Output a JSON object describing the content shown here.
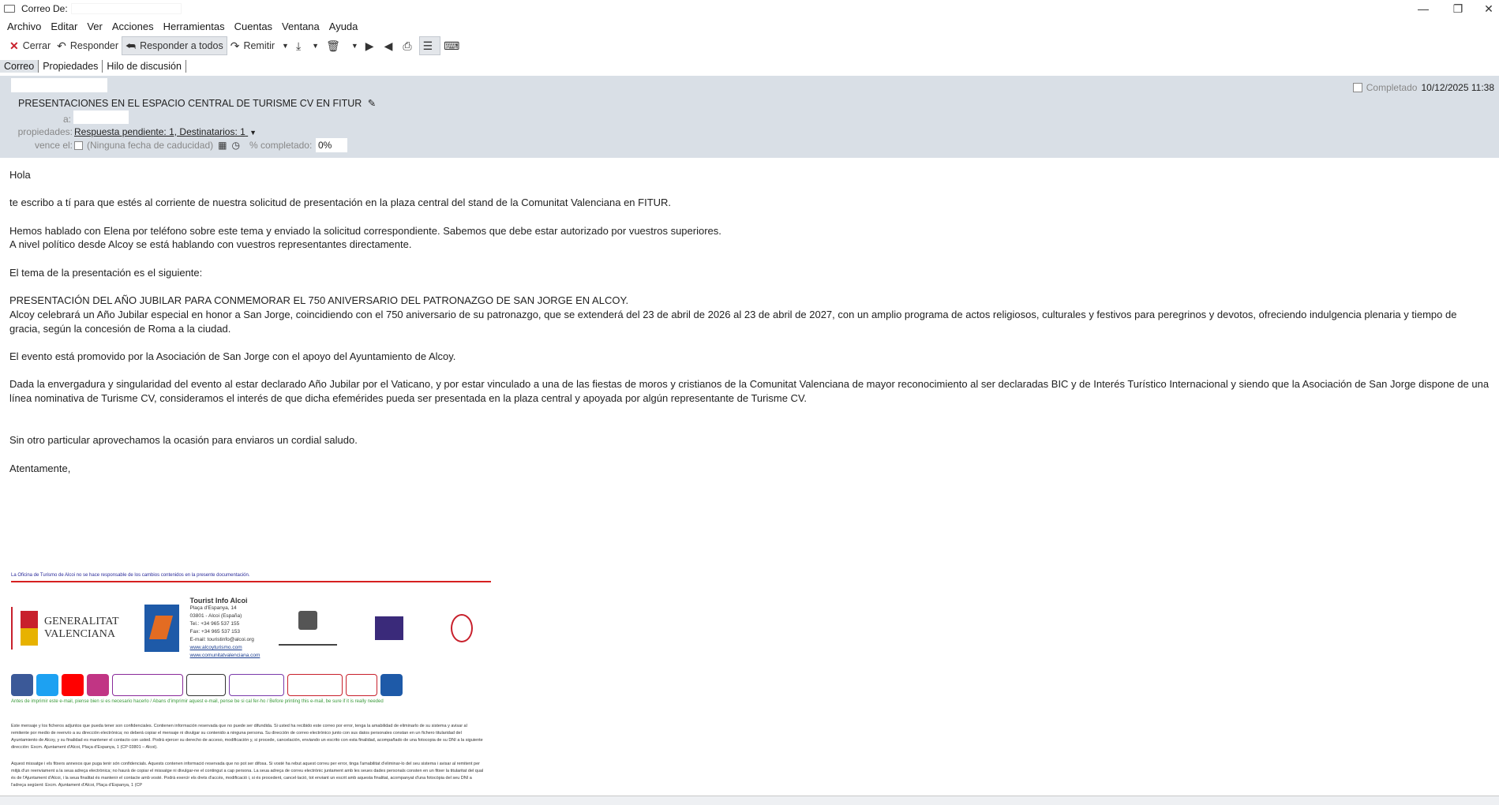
{
  "window": {
    "title": "Correo De:",
    "minimize": "—",
    "maximize": "❐",
    "close": "✕"
  },
  "menu": [
    "Archivo",
    "Editar",
    "Ver",
    "Acciones",
    "Herramientas",
    "Cuentas",
    "Ventana",
    "Ayuda"
  ],
  "toolbar": {
    "close_label": "Cerrar",
    "reply_label": "Responder",
    "reply_all_label": "Responder a todos",
    "forward_label": "Remitir"
  },
  "tabs": [
    "Correo",
    "Propiedades",
    "Hilo de discusión"
  ],
  "header": {
    "subject": "PRESENTACIONES EN EL ESPACIO CENTRAL DE TURISME CV EN FITUR",
    "completed_label": "Completado",
    "date": "10/12/2025 11:38",
    "to_label": "a:",
    "props_label": "propiedades:",
    "props_value": "Respuesta pendiente: 1, Destinatarios: 1",
    "expires_label": "vence el:",
    "expires_value": "(Ninguna fecha de caducidad)",
    "pct_label": "% completado:",
    "pct_value": "0%"
  },
  "body": {
    "p1": "Hola",
    "p2": "te escribo a tí para que estés al corriente de nuestra solicitud de presentación en la plaza central del stand de la Comunitat Valenciana en FITUR.",
    "p3a": "Hemos hablado con Elena por teléfono sobre este tema y enviado la solicitud correspondiente. Sabemos que debe estar autorizado por vuestros superiores.",
    "p3b": "A nivel político desde Alcoy se está hablando con vuestros representantes directamente.",
    "p4": "El tema de la presentación es el siguiente:",
    "p5a": "PRESENTACIÓN DEL AÑO JUBILAR PARA CONMEMORAR EL 750 ANIVERSARIO DEL PATRONAZGO DE SAN JORGE EN ALCOY.",
    "p5b": "Alcoy celebrará un Año Jubilar especial en honor a San Jorge, coincidiendo con el 750 aniversario de su patronazgo, que se extenderá del 23 de abril de 2026 al 23 de abril de 2027, con un amplio programa de actos religiosos, culturales y festivos para peregrinos y devotos, ofreciendo indulgencia plenaria y tiempo de gracia, según la concesión de Roma a la ciudad.",
    "p6": "El evento está promovido por la Asociación de San Jorge con el apoyo del Ayuntamiento de Alcoy.",
    "p7": "Dada la envergadura y singularidad del evento al estar declarado Año Jubilar por el Vaticano, y por estar vinculado a una de las fiestas de moros y cristianos de la Comunitat Valenciana de mayor reconocimiento al ser declaradas BIC y de Interés Turístico Internacional y siendo que la Asociación de San Jorge dispone de una línea nominativa de Turisme CV, consideramos el interés de que dicha efemérides pueda ser presentada en la plaza central y apoyada por algún representante de Turisme CV.",
    "p8": "Sin otro particular aprovechamos la ocasión para enviaros un cordial saludo.",
    "p9": "Atentamente,"
  },
  "signature": {
    "disclaimer": "La Oficina de Turismo de Alcoi no se hace responsable de los cambios contenidos en la presente documentación.",
    "gva_line1": "GENERALITAT",
    "gva_line2": "VALENCIANA",
    "office": "Tourist Info Alcoi",
    "addr1": "Plaça d'Espanya, 14",
    "addr2": "03801 - Alcoi (España)",
    "tel": "Tel.: +34 965 537 155",
    "fax": "Fax: +34 965 537 153",
    "email": "E-mail: touristinfo@alcoi.org",
    "web1": "www.alcoyturismo.com",
    "web2": "www.comunitatvalenciana.com",
    "green": "Antes de imprimir este e-mail, piense bien si es necesario hacerlo / Abans d'imprimir aquest e-mail, pense be si cal fer-ho / Before printing this e-mail, be sure if it is really needed",
    "legal_es": "Este mensaje y los ficheros adjuntos que pueda tener son confidenciales. Contienen información reservada que no puede ser difundida. Si usted ha recibido este correo por error, tenga la amabilidad de eliminarlo de su sistema y avisar al remitente por medio de reenvío a su dirección electrónica; no deberá copiar el mensaje ni divulgar su contenido a ninguna persona. Su dirección de correo electrónico junto con sus datos personales constan en un fichero titularidad del Ayuntamiento de Alcoy, y su finalidad es mantener el contacto con usted. Podrá ejercer su derecho de acceso, modificación y, si procede, cancelación, enviando un escrito con esta finalidad, acompañado de una fotocopia de su DNI a la siguiente dirección: Excm. Ajuntament d'Alcoi, Plaça d'Espanya, 1 (CP 03801 – Alcoi).",
    "legal_va": "Aquest missatge i els fitxers annexos que puga tenir són confidencials. Aquests contenen informació reservada que no pot ser difosa. Si vosté ha rebut aquest correu per error, tinga l'amabilitat d'eliminar-lo del seu sistema i avisar al remitent per mitjà d'un reenviament a la seua adreça electrònica; no haurà de copiar el missatge ni divulgar-ne el contingut a cap persona. La seua adreça de correu electrònic juntament amb les seues dades personals consten en un fitxer la titularitat del qual és de l'Ajuntament d'Alcoi, i la seua finalitat és mantenir el contacte amb vosté. Podrà exercir els drets d'accés, modificació i, si és procedent, cancel·lació, tot enviant un escrit amb aquesta finalitat, acompanyat d'una fotocòpia del seu DNI a l'adreça següent: Excm. Ajuntament d'Alcoi, Plaça d'Espanya, 1 (CP"
  },
  "colors": {
    "header_bg": "#d9dfe6",
    "close_red": "#c8202c",
    "accent_blue": "#1e5aa8"
  }
}
